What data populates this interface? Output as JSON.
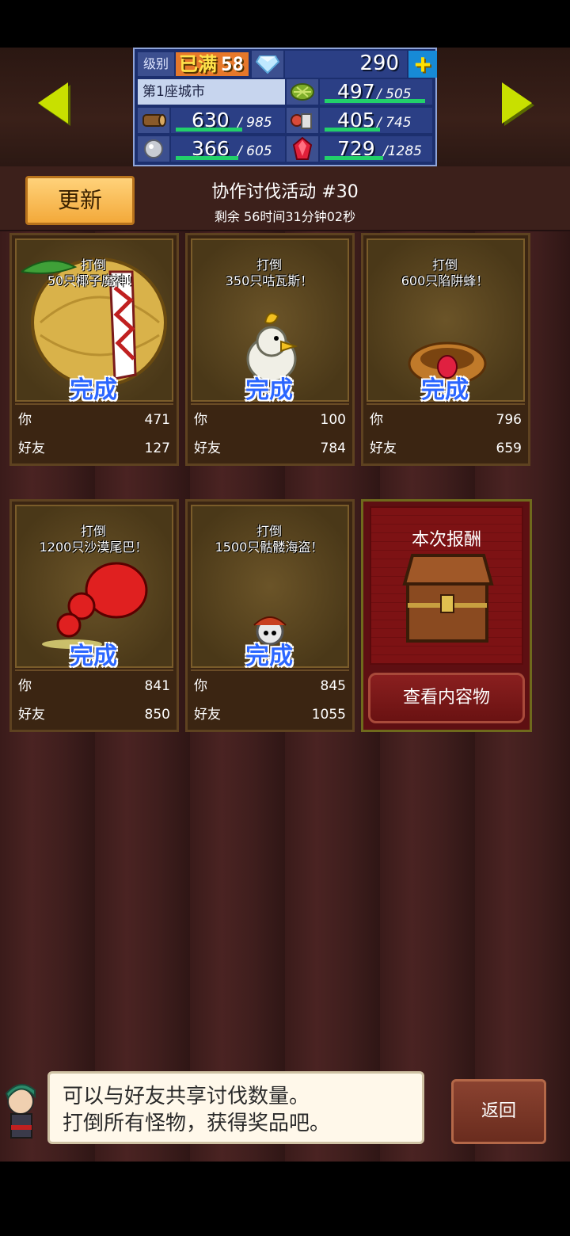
{
  "hud": {
    "level_label": "级别",
    "level_max": "已满",
    "level_value": "58",
    "gems": "290",
    "city": "第1座城市",
    "wood": {
      "cur": "630",
      "max": "/ 985",
      "fill": 0.64
    },
    "grass": {
      "cur": "497",
      "max": "/ 505",
      "fill": 0.98
    },
    "food": {
      "cur": "405",
      "max": "/ 745",
      "fill": 0.54
    },
    "ore": {
      "cur": "366",
      "max": "/ 605",
      "fill": 0.6
    },
    "ruby": {
      "cur": "729",
      "max": "/1285",
      "fill": 0.57
    }
  },
  "header": {
    "refresh_label": "更新",
    "event_title": "协作讨伐活动 #30",
    "time_left": "剩余 56时间31分钟02秒"
  },
  "cards": [
    {
      "line1": "打倒",
      "line2": "50只椰子魔神！",
      "status": "完成",
      "you_label": "你",
      "you": "471",
      "friend_label": "好友",
      "friend": "127"
    },
    {
      "line1": "打倒",
      "line2": "350只咕瓦斯！",
      "status": "完成",
      "you_label": "你",
      "you": "100",
      "friend_label": "好友",
      "friend": "784"
    },
    {
      "line1": "打倒",
      "line2": "600只陷阱蜂！",
      "status": "完成",
      "you_label": "你",
      "you": "796",
      "friend_label": "好友",
      "friend": "659"
    },
    {
      "line1": "打倒",
      "line2": "1200只沙漠尾巴！",
      "status": "完成",
      "you_label": "你",
      "you": "841",
      "friend_label": "好友",
      "friend": "850"
    },
    {
      "line1": "打倒",
      "line2": "1500只骷髅海盗！",
      "status": "完成",
      "you_label": "你",
      "you": "845",
      "friend_label": "好友",
      "friend": "1055"
    }
  ],
  "reward": {
    "title": "本次报酬",
    "button": "查看内容物"
  },
  "dialog": {
    "line1": "可以与好友共享讨伐数量。",
    "line2": "打倒所有怪物，获得奖品吧。"
  },
  "back_label": "返回",
  "colors": {
    "accent": "#2b66ff",
    "bar": "#22d06a",
    "refresh": "#f3a93a"
  }
}
